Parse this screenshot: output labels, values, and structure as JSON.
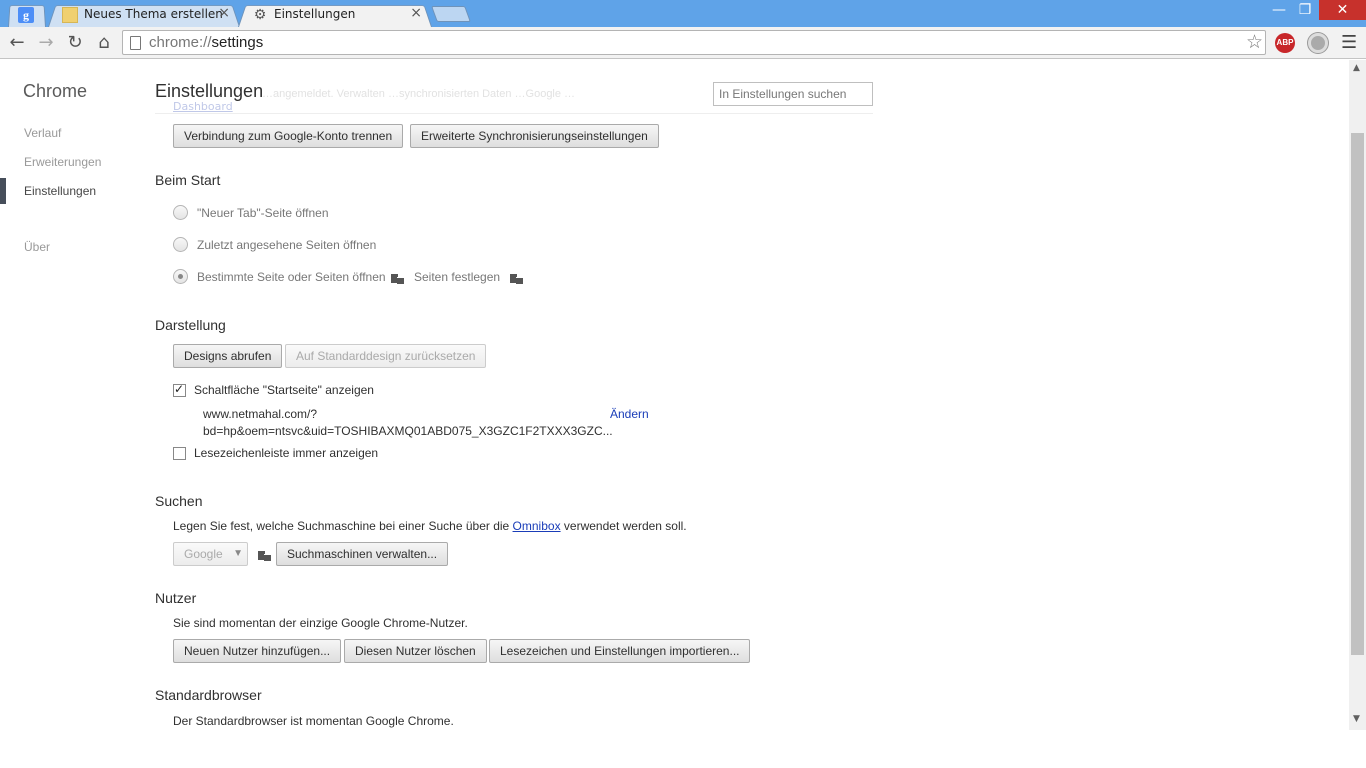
{
  "tabs": [
    {
      "title": "",
      "icon": "google-icon",
      "glyph": "g"
    },
    {
      "title": "Neues Thema erstellen - T",
      "icon": "forum-favicon"
    },
    {
      "title": "Einstellungen",
      "icon": "gear-icon"
    }
  ],
  "window": {
    "minimize": "—",
    "maximize": "❐",
    "close": "✕"
  },
  "toolbar": {
    "url_scheme": "chrome://",
    "url_path": "settings",
    "abp_label": "ABP"
  },
  "sidebar": {
    "title": "Chrome",
    "items": [
      {
        "label": "Verlauf"
      },
      {
        "label": "Erweiterungen"
      },
      {
        "label": "Einstellungen"
      },
      {
        "label": "Über"
      }
    ]
  },
  "header": {
    "title": "Einstellungen",
    "search_placeholder": "In Einstellungen suchen",
    "faded_text": "…angemeldet. Verwalten …synchronisierten Daten …Google …",
    "faded_link": "Dashboard"
  },
  "sync": {
    "disconnect_button": "Verbindung zum Google-Konto trennen",
    "advanced_sync_button": "Erweiterte Synchronisierungseinstellungen"
  },
  "startup": {
    "title": "Beim Start",
    "options": [
      {
        "label": "\"Neuer Tab\"-Seite öffnen",
        "checked": false
      },
      {
        "label": "Zuletzt angesehene Seiten öffnen",
        "checked": false
      },
      {
        "label": "Bestimmte Seite oder Seiten öffnen",
        "checked": true
      }
    ],
    "set_pages_link": "Seiten festlegen"
  },
  "appearance": {
    "title": "Darstellung",
    "get_themes_button": "Designs abrufen",
    "reset_theme_button": "Auf Standarddesign zurücksetzen",
    "show_home_label": "Schaltfläche \"Startseite\" anzeigen",
    "show_home_checked": true,
    "home_url_line1": "www.netmahal.com/?",
    "home_url_line2": "bd=hp&oem=ntsvc&uid=TOSHIBAXMQ01ABD075_X3GZC1F2TXXX3GZC...",
    "change_link": "Ändern",
    "bookmarks_bar_label": "Lesezeichenleiste immer anzeigen",
    "bookmarks_bar_checked": false
  },
  "search": {
    "title": "Suchen",
    "desc_before": "Legen Sie fest, welche Suchmaschine bei einer Suche über die ",
    "desc_link": "Omnibox",
    "desc_after": " verwendet werden soll.",
    "engine_selected": "Google",
    "manage_button": "Suchmaschinen verwalten..."
  },
  "users": {
    "title": "Nutzer",
    "desc": "Sie sind momentan der einzige Google Chrome-Nutzer.",
    "add_button": "Neuen Nutzer hinzufügen...",
    "delete_button": "Diesen Nutzer löschen",
    "import_button": "Lesezeichen und Einstellungen importieren..."
  },
  "default_browser": {
    "title": "Standardbrowser",
    "desc": "Der Standardbrowser ist momentan Google Chrome."
  }
}
